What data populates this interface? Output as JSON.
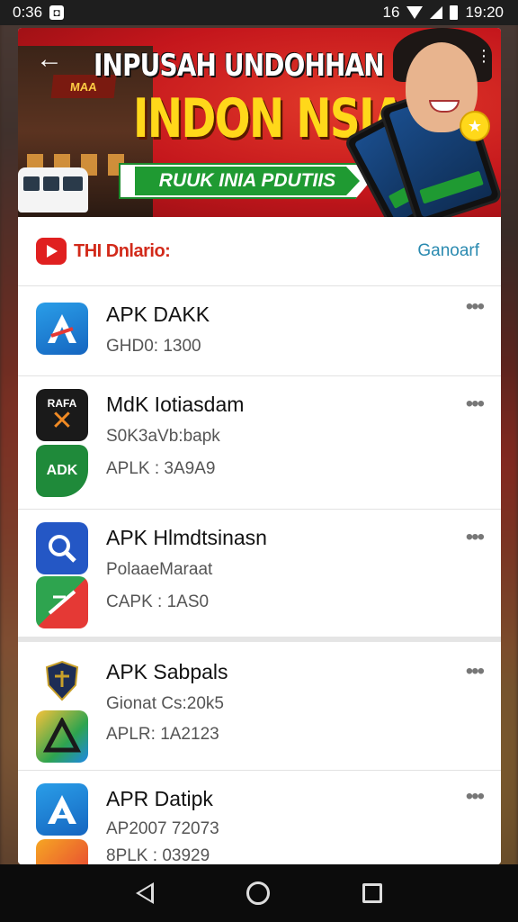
{
  "status_bar": {
    "time_left": "0:36",
    "time_right": "19:20",
    "network": "16"
  },
  "banner": {
    "title": "INPUSAH UNDOHHAN",
    "headline": "INDON NSIA",
    "ribbon": "RUUK INIA PDUTIIS",
    "sign_text": "MAA"
  },
  "section": {
    "title": "THI Dnlario:",
    "action": "Ganoarf"
  },
  "apps": [
    {
      "name": "APK DAKK",
      "lines": [
        "GHD0: 1300"
      ],
      "icon": "apk-blue-a-icon"
    },
    {
      "name": "MdK Iotiasdam",
      "lines": [
        "S0K3aVb:bapk",
        "APLK : 3A9A9"
      ],
      "icon": "rafa-x-icon",
      "icon_text": "RAFA",
      "icon2_text": "ADK"
    },
    {
      "name": "APK Hlmdtsinasn",
      "lines": [
        "PolaaeMaraat",
        "CAPK : 1AS0"
      ],
      "icon": "search-app-icon"
    },
    {
      "name": "APK Sabpals",
      "lines": [
        "Gionat Cs:20k5",
        "APLR: 1A2123"
      ],
      "icon": "shield-app-icon"
    },
    {
      "name": "APR Datipk",
      "lines": [
        "AP2007 72073",
        "8PLK : 03929"
      ],
      "icon": "apk-blue-a-icon"
    }
  ],
  "colors": {
    "banner_red": "#c4161c",
    "headline_yellow": "#ffd81a",
    "ribbon_green": "#1f9a32",
    "section_title": "#d22a1a",
    "link_blue": "#2a8ab0"
  }
}
